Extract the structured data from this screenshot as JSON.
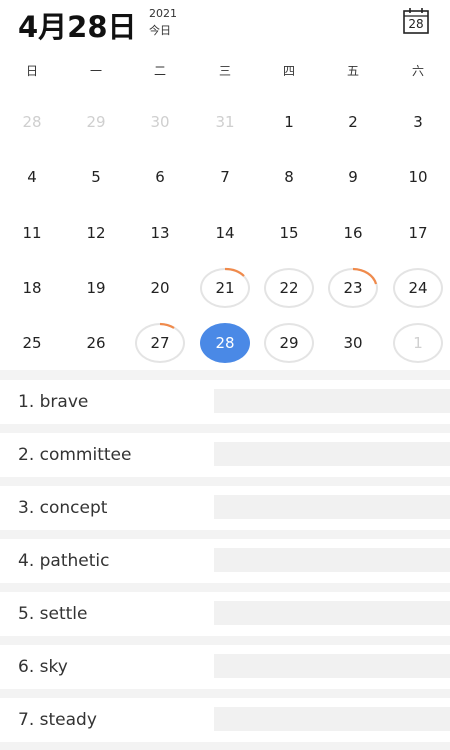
{
  "header": {
    "date_label": "4月28日",
    "year": "2021",
    "today_label": "今日",
    "calendar_icon_day": "28"
  },
  "weekdays": [
    "日",
    "一",
    "二",
    "三",
    "四",
    "五",
    "六"
  ],
  "weeks": [
    [
      "28",
      "29",
      "30",
      "31",
      "1",
      "2",
      "3"
    ],
    [
      "4",
      "5",
      "6",
      "7",
      "8",
      "9",
      "10"
    ],
    [
      "11",
      "12",
      "13",
      "14",
      "15",
      "16",
      "17"
    ],
    [
      "18",
      "19",
      "20",
      "21",
      "22",
      "23",
      "24"
    ],
    [
      "25",
      "26",
      "27",
      "28",
      "29",
      "30",
      "1"
    ]
  ],
  "colors": {
    "selected": "#4a89e6",
    "progress_arc": "#f08a4b",
    "ring": "#e4e4e4"
  },
  "words": [
    "1. brave",
    "2. committee",
    "3. concept",
    "4. pathetic",
    "5. settle",
    "6. sky",
    "7. steady"
  ]
}
